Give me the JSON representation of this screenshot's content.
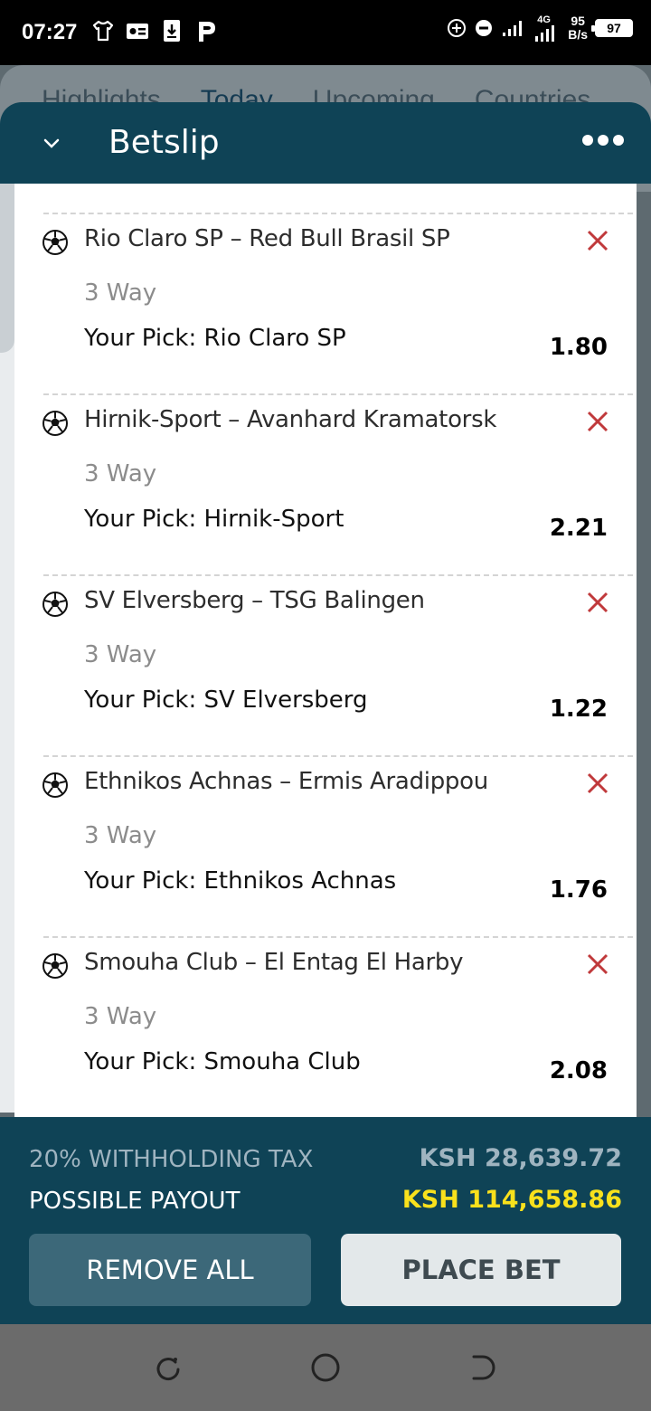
{
  "status_bar": {
    "time": "07:27",
    "left_icons": [
      "tshirt-icon",
      "card-icon",
      "download-icon",
      "p-icon"
    ],
    "right_icons": [
      "add-circle-icon",
      "do-not-disturb-icon",
      "signal-icon",
      "signal-4g-icon"
    ],
    "network_type": "4G",
    "speed_value": "95",
    "speed_unit": "B/s",
    "battery": "97"
  },
  "background_app": {
    "tabs": [
      "Highlights",
      "Today",
      "Upcoming",
      "Countries"
    ],
    "active_tab": "Today"
  },
  "betslip": {
    "title": "Betslip",
    "collapse_icon": "chevron-down-icon",
    "menu_icon": "more-horizontal-icon",
    "bets": [
      {
        "match": "Rio Claro SP – Red Bull Brasil SP",
        "market": "3 Way",
        "pick": "Your Pick: Rio Claro SP",
        "odds": "1.80"
      },
      {
        "match": "Hirnik-Sport – Avanhard Kramatorsk",
        "market": "3 Way",
        "pick": "Your Pick: Hirnik-Sport",
        "odds": "2.21"
      },
      {
        "match": "SV Elversberg – TSG Balingen",
        "market": "3 Way",
        "pick": "Your Pick: SV Elversberg",
        "odds": "1.22"
      },
      {
        "match": "Ethnikos Achnas – Ermis Aradippou",
        "market": "3 Way",
        "pick": "Your Pick: Ethnikos Achnas",
        "odds": "1.76"
      },
      {
        "match": "Smouha Club – El Entag El Harby",
        "market": "3 Way",
        "pick": "Your Pick: Smouha Club",
        "odds": "2.08"
      }
    ]
  },
  "footer": {
    "tax_label": "20% WITHHOLDING TAX",
    "tax_value": "KSH 28,639.72",
    "payout_label": "POSSIBLE PAYOUT",
    "payout_value": "KSH 114,658.86",
    "remove_all_label": "REMOVE ALL",
    "place_bet_label": "PLACE BET"
  },
  "colors": {
    "header": "#0f4356",
    "payout": "#f9e11c",
    "remove_x": "#c0393b",
    "remove_button": "#3c6879",
    "place_button": "#e3e8ea"
  },
  "nav_bar": {
    "icons": [
      "recents-icon",
      "home-icon",
      "back-icon"
    ]
  }
}
